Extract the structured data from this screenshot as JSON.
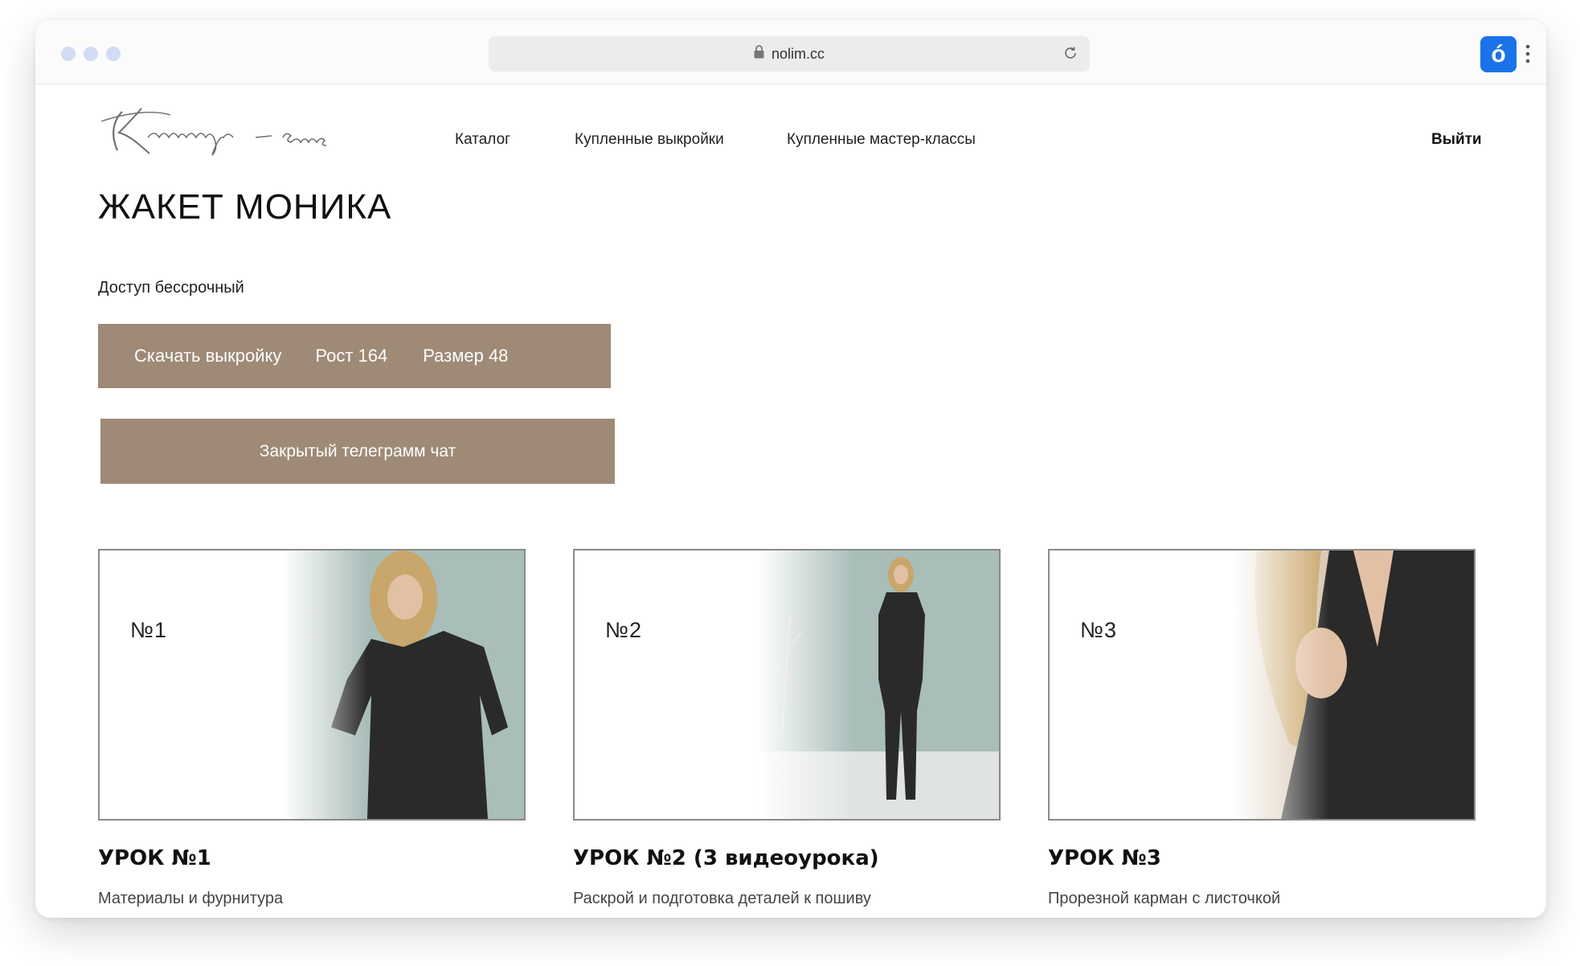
{
  "browser": {
    "url": "nolim.cc",
    "extension_label": "ó"
  },
  "header": {
    "logo_text": "Kaminskaya sews",
    "nav": [
      "Каталог",
      "Купленные выкройки",
      "Купленные мастер-классы"
    ],
    "logout": "Выйти"
  },
  "main": {
    "title": "ЖАКЕТ МОНИКА",
    "access": "Доступ бессрочный",
    "download": {
      "label": "Скачать выкройку",
      "height": "Рост 164",
      "size": "Размер 48"
    },
    "telegram": "Закрытый телеграмм чат"
  },
  "lessons": [
    {
      "number": "№1",
      "title": "УРОК №1",
      "subtitle": "Материалы и фурнитура"
    },
    {
      "number": "№2",
      "title": "УРОК №2 (3 видеоурока)",
      "subtitle": "Раскрой и подготовка деталей к пошиву"
    },
    {
      "number": "№3",
      "title": "УРОК №3",
      "subtitle": "Прорезной карман с листочкой"
    }
  ],
  "colors": {
    "accent": "#9e8a76",
    "photo_background": "#a9bdb9",
    "jacket": "#2a2a2a",
    "extension": "#1a73e8"
  },
  "icons": [
    "lock-icon",
    "reload-icon",
    "kebab-menu-icon"
  ]
}
